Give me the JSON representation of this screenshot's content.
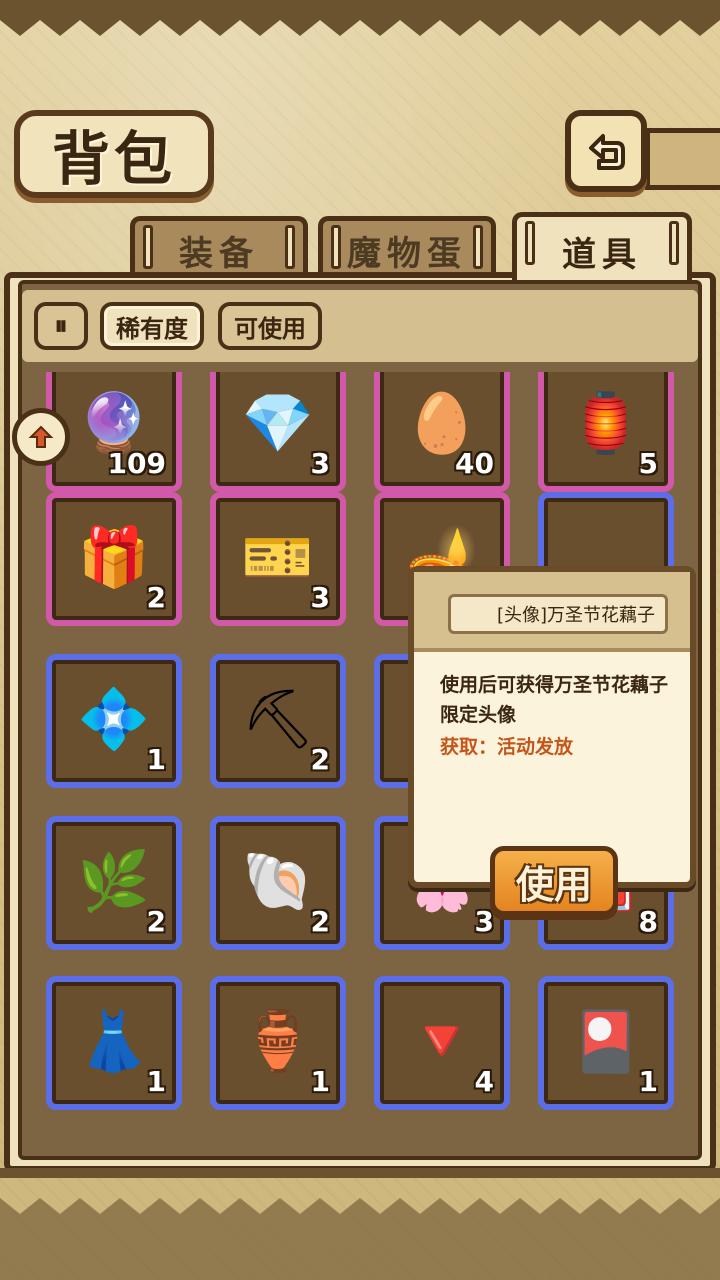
{
  "screen": {
    "title": "背包",
    "back_icon": "back-arrow-icon"
  },
  "tabs": [
    {
      "label": "装备",
      "active": false
    },
    {
      "label": "魔物蛋",
      "active": false
    },
    {
      "label": "道具",
      "active": true
    }
  ],
  "filters": {
    "pause_icon": "⏸",
    "rarity": "稀有度",
    "usable": "可使用"
  },
  "side_button_icon": "collapse-arrow-icon",
  "items": [
    {
      "name": "blue-orb",
      "icon": "🔮",
      "count": "109",
      "rarity": "epic"
    },
    {
      "name": "blue-crystal",
      "icon": "💎",
      "count": "3",
      "rarity": "epic"
    },
    {
      "name": "rainbow-egg",
      "icon": "🥚",
      "count": "40",
      "rarity": "epic"
    },
    {
      "name": "lantern",
      "icon": "🏮",
      "count": "5",
      "rarity": "epic"
    },
    {
      "name": "gift-box",
      "icon": "🎁",
      "count": "2",
      "rarity": "epic"
    },
    {
      "name": "green-ticket",
      "icon": "🎫",
      "count": "3",
      "rarity": "epic"
    },
    {
      "name": "yellow-lantern",
      "icon": "🪔",
      "count": "",
      "rarity": "epic"
    },
    {
      "name": "avatar-item",
      "icon": "",
      "count": "",
      "rarity": "rare"
    },
    {
      "name": "ice-crystal",
      "icon": "💠",
      "count": "1",
      "rarity": "rare"
    },
    {
      "name": "pickaxe",
      "icon": "⛏",
      "count": "2",
      "rarity": "rare"
    },
    {
      "name": "red-shield",
      "icon": "🛡",
      "count": "",
      "rarity": "rare"
    },
    {
      "name": "hidden-item",
      "icon": "",
      "count": "",
      "rarity": "rare"
    },
    {
      "name": "herb",
      "icon": "🌿",
      "count": "2",
      "rarity": "rare"
    },
    {
      "name": "shells",
      "icon": "🐚",
      "count": "2",
      "rarity": "rare"
    },
    {
      "name": "flower",
      "icon": "🌸",
      "count": "3",
      "rarity": "rare"
    },
    {
      "name": "red-book",
      "icon": "📕",
      "count": "8",
      "rarity": "rare"
    },
    {
      "name": "rainbow-dress",
      "icon": "👗",
      "count": "1",
      "rarity": "rare"
    },
    {
      "name": "perfume-bottle",
      "icon": "🏺",
      "count": "1",
      "rarity": "rare"
    },
    {
      "name": "red-crystal",
      "icon": "🔻",
      "count": "4",
      "rarity": "rare"
    },
    {
      "name": "avatar-card",
      "icon": "🎴",
      "count": "1",
      "rarity": "rare"
    }
  ],
  "tooltip": {
    "item_name": "[头像]万圣节花藕子",
    "description": "使用后可获得万圣节花藕子限定头像",
    "source_label": "获取：",
    "source_value": "活动发放",
    "use_button": "使用"
  }
}
